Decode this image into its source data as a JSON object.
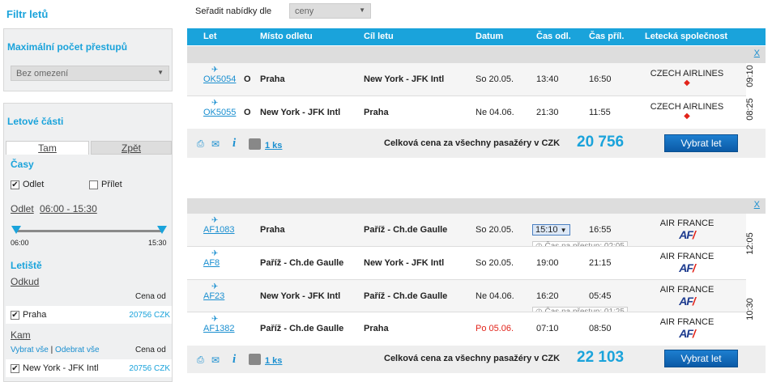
{
  "sidebar": {
    "title": "Filtr letů",
    "max_transfers": {
      "heading": "Maximální počet přestupů",
      "select_value": "Bez omezení"
    },
    "parts": {
      "heading": "Letové části",
      "tabs": [
        "Tam",
        "Zpět"
      ],
      "times_heading": "Časy",
      "chk_departure": "Odlet",
      "chk_arrival": "Přílet",
      "range_label": "Odlet",
      "range_value": "06:00 - 15:30",
      "slider_min": "06:00",
      "slider_max": "15:30",
      "airport_heading": "Letiště",
      "from_label": "Odkud",
      "price_from": "Cena od",
      "from_item": "Praha",
      "from_price": "20756 CZK",
      "to_label": "Kam",
      "select_all": "Vybrat vše",
      "separator": "|",
      "deselect_all": "Odebrat vše",
      "price_from2": "Cena od",
      "to_item": "New York - JFK Intl",
      "to_price": "20756 CZK"
    }
  },
  "sort": {
    "label": "Seřadit nabídky dle",
    "value": "ceny"
  },
  "table": {
    "headers": [
      "Let",
      "Místo odletu",
      "Cíl letu",
      "Datum",
      "Čas odl.",
      "Čas příl.",
      "Letecká společnost"
    ]
  },
  "offers": [
    {
      "close": "X",
      "legs": [
        {
          "flight": "OK5054",
          "mark": "O",
          "from": "Praha",
          "to": "New York - JFK Intl",
          "date": "So 20.05.",
          "dep": "13:40",
          "arr": "16:50",
          "airline": "CZECH AIRLINES",
          "duration": "09:10"
        },
        {
          "flight": "OK5055",
          "mark": "O",
          "from": "New York - JFK Intl",
          "to": "Praha",
          "date": "Ne 04.06.",
          "dep": "21:30",
          "arr": "11:55",
          "airline": "CZECH AIRLINES",
          "duration": "08:25"
        }
      ],
      "bags": "1 ks",
      "total_label": "Celková cena za všechny pasažéry v CZK",
      "price": "20 756",
      "button": "Vybrat let"
    },
    {
      "close": "X",
      "legs": [
        {
          "flight": "AF1083",
          "from": "Praha",
          "to": "Paříž - Ch.de Gaulle",
          "date": "So 20.05.",
          "dep": "15:10",
          "arr": "16:55",
          "airline": "AIR FRANCE",
          "logo": "AF"
        },
        {
          "flight": "AF8",
          "from": "Paříž - Ch.de Gaulle",
          "to": "New York - JFK Intl",
          "date": "So 20.05.",
          "dep": "19:00",
          "arr": "21:15",
          "airline": "AIR FRANCE",
          "logo": "AF"
        },
        {
          "flight": "AF23",
          "from": "New York - JFK Intl",
          "to": "Paříž - Ch.de Gaulle",
          "date": "Ne 04.06.",
          "dep": "16:20",
          "arr": "05:45",
          "airline": "AIR FRANCE",
          "logo": "AF"
        },
        {
          "flight": "AF1382",
          "from": "Paříž - Ch.de Gaulle",
          "to": "Praha",
          "date": "Po 05.06.",
          "dep": "07:10",
          "arr": "08:50",
          "airline": "AIR FRANCE",
          "logo": "AF"
        }
      ],
      "transfer1": "Čas na přestup: 02:05",
      "transfer2": "Čas na přestup: 01:25",
      "duration_out": "12:05",
      "duration_back": "10:30",
      "bags": "1 ks",
      "total_label": "Celková cena za všechny pasažéry v CZK",
      "price": "22 103",
      "button": "Vybrat let"
    }
  ],
  "colors": {
    "accent": "#1aa3db",
    "button": "#0b5aa6",
    "weekend_date": "#e2231a"
  }
}
